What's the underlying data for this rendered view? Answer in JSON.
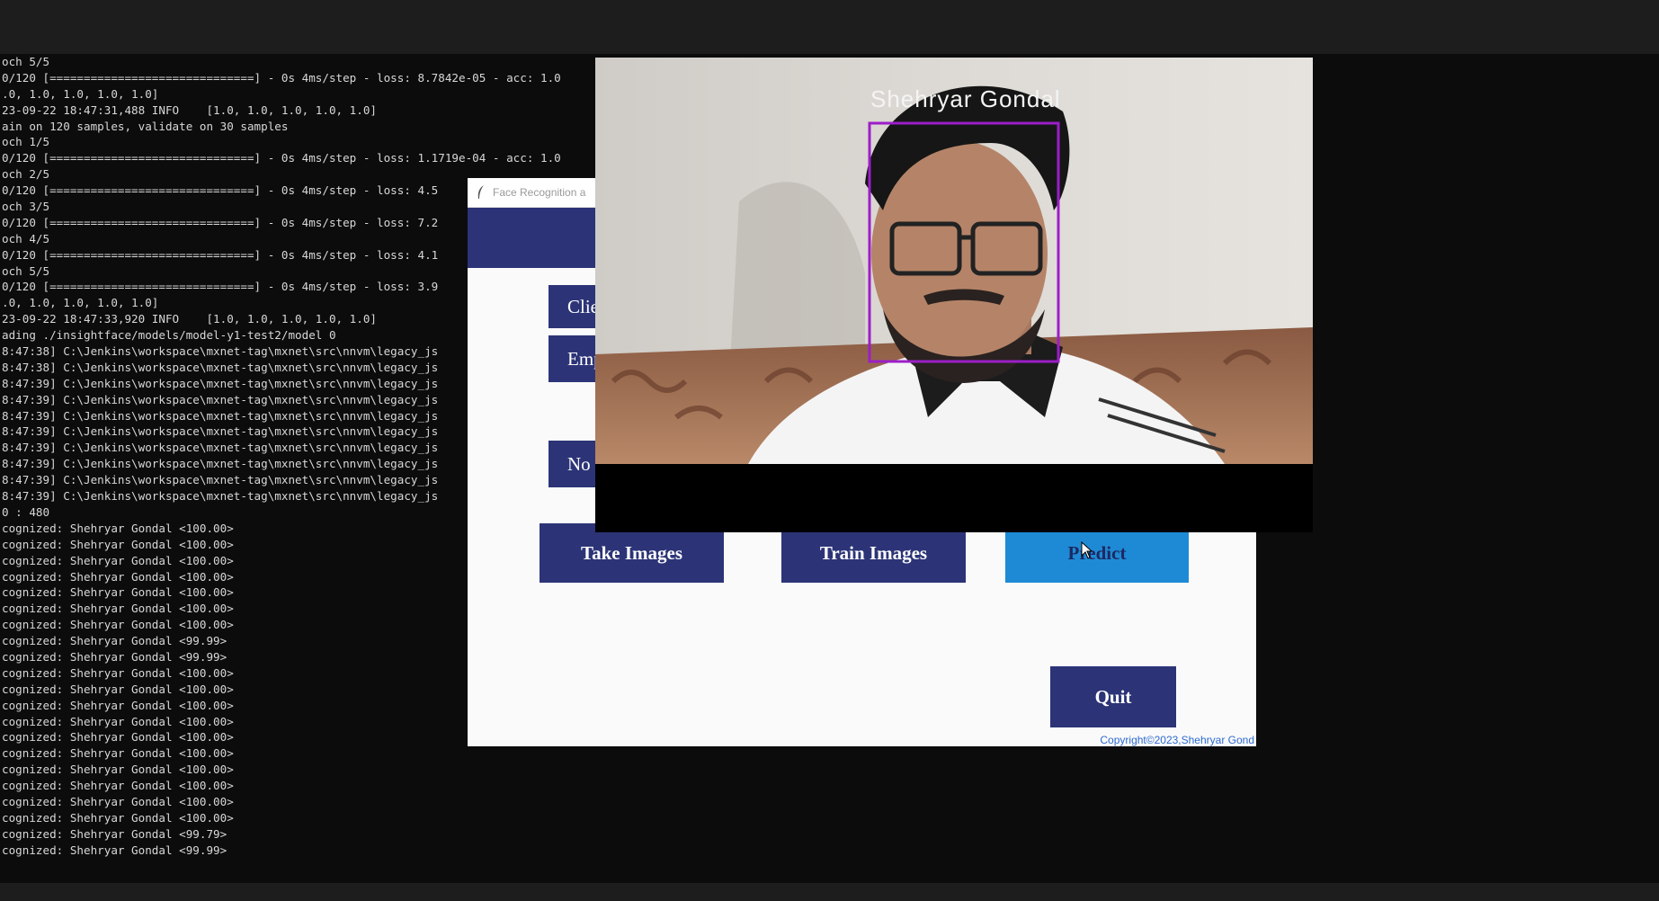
{
  "console": {
    "lines": [
      "och 5/5",
      "0/120 [==============================] - 0s 4ms/step - loss: 8.7842e-05 - acc: 1.0",
      ".0, 1.0, 1.0, 1.0, 1.0]",
      "23-09-22 18:47:31,488 INFO    [1.0, 1.0, 1.0, 1.0, 1.0]",
      "ain on 120 samples, validate on 30 samples",
      "och 1/5",
      "0/120 [==============================] - 0s 4ms/step - loss: 1.1719e-04 - acc: 1.0",
      "och 2/5",
      "0/120 [==============================] - 0s 4ms/step - loss: 4.5",
      "och 3/5",
      "0/120 [==============================] - 0s 4ms/step - loss: 7.2",
      "och 4/5",
      "0/120 [==============================] - 0s 4ms/step - loss: 4.1",
      "och 5/5",
      "0/120 [==============================] - 0s 4ms/step - loss: 3.9",
      ".0, 1.0, 1.0, 1.0, 1.0]",
      "23-09-22 18:47:33,920 INFO    [1.0, 1.0, 1.0, 1.0, 1.0]",
      "ading ./insightface/models/model-y1-test2/model 0",
      "8:47:38] C:\\Jenkins\\workspace\\mxnet-tag\\mxnet\\src\\nnvm\\legacy_js",
      "8:47:38] C:\\Jenkins\\workspace\\mxnet-tag\\mxnet\\src\\nnvm\\legacy_js",
      "8:47:39] C:\\Jenkins\\workspace\\mxnet-tag\\mxnet\\src\\nnvm\\legacy_js",
      "8:47:39] C:\\Jenkins\\workspace\\mxnet-tag\\mxnet\\src\\nnvm\\legacy_js",
      "8:47:39] C:\\Jenkins\\workspace\\mxnet-tag\\mxnet\\src\\nnvm\\legacy_js",
      "8:47:39] C:\\Jenkins\\workspace\\mxnet-tag\\mxnet\\src\\nnvm\\legacy_js",
      "8:47:39] C:\\Jenkins\\workspace\\mxnet-tag\\mxnet\\src\\nnvm\\legacy_js",
      "8:47:39] C:\\Jenkins\\workspace\\mxnet-tag\\mxnet\\src\\nnvm\\legacy_js",
      "8:47:39] C:\\Jenkins\\workspace\\mxnet-tag\\mxnet\\src\\nnvm\\legacy_js",
      "8:47:39] C:\\Jenkins\\workspace\\mxnet-tag\\mxnet\\src\\nnvm\\legacy_js",
      "0 : 480",
      "cognized: Shehryar Gondal <100.00>",
      "cognized: Shehryar Gondal <100.00>",
      "cognized: Shehryar Gondal <100.00>",
      "cognized: Shehryar Gondal <100.00>",
      "cognized: Shehryar Gondal <100.00>",
      "cognized: Shehryar Gondal <100.00>",
      "cognized: Shehryar Gondal <100.00>",
      "cognized: Shehryar Gondal <99.99>",
      "cognized: Shehryar Gondal <99.99>",
      "cognized: Shehryar Gondal <100.00>",
      "cognized: Shehryar Gondal <100.00>",
      "cognized: Shehryar Gondal <100.00>",
      "cognized: Shehryar Gondal <100.00>",
      "cognized: Shehryar Gondal <100.00>",
      "cognized: Shehryar Gondal <100.00>",
      "cognized: Shehryar Gondal <100.00>",
      "cognized: Shehryar Gondal <100.00>",
      "cognized: Shehryar Gondal <100.00>",
      "cognized: Shehryar Gondal <100.00>",
      "cognized: Shehryar Gondal <99.79>",
      "cognized: Shehryar Gondal <99.99>"
    ]
  },
  "app": {
    "title": "Face Recognition a",
    "icon": "feather-icon",
    "buttons": {
      "clients": "Clie",
      "employee": "Emp",
      "notification": "No",
      "take_images": "Take Images",
      "train_images": "Train Images",
      "predict": "Predict",
      "quit": "Quit"
    },
    "copyright": "Copyright©2023,Shehryar Gond",
    "colors": {
      "button": "#2c3477",
      "predict_active": "#1e8ad6"
    }
  },
  "camera": {
    "recognized_name": "Shehryar Gondal",
    "box_color": "#9c1ec8"
  }
}
